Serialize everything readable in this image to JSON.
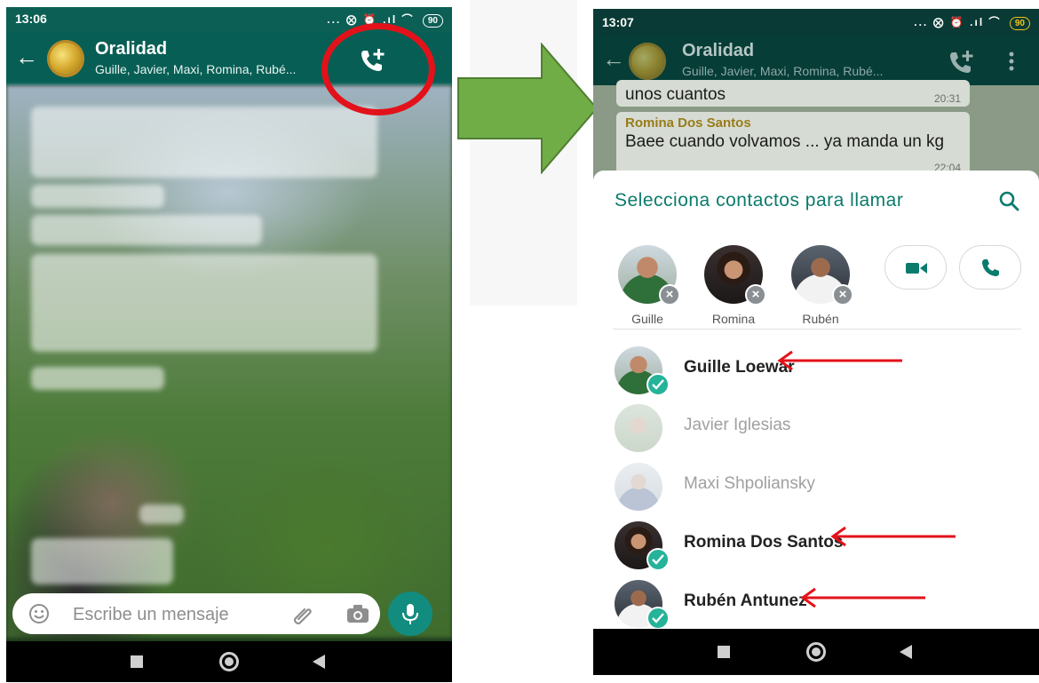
{
  "left_screen": {
    "status_time": "13:06",
    "status_icons": "... ⨂ ⏰ .ıl ⌒",
    "battery": "90",
    "chat": {
      "title": "Oralidad",
      "members": "Guille, Javier, Maxi, Romina, Rubé..."
    },
    "input": {
      "placeholder": "Escribe un mensaje"
    }
  },
  "right_screen": {
    "status_time": "13:07",
    "status_icons": "... ⨂ ⏰ .ıl ⌒",
    "battery": "90",
    "chat": {
      "title": "Oralidad",
      "members": "Guille, Javier, Maxi, Romina, Rubé..."
    },
    "messages": [
      {
        "sender": "",
        "text": "unos cuantos",
        "time": "20:31"
      },
      {
        "sender": "Romina Dos Santos",
        "text": "Baee cuando volvamos ... ya manda un kg",
        "time": "22:04"
      }
    ],
    "sheet": {
      "title": "Selecciona contactos para llamar",
      "selected_chips": [
        {
          "label": "Guille"
        },
        {
          "label": "Romina"
        },
        {
          "label": "Rubén"
        }
      ],
      "contacts": [
        {
          "name": "Guille Loewar",
          "selected": true
        },
        {
          "name": "Javier Iglesias",
          "selected": false
        },
        {
          "name": "Maxi Shpoliansky",
          "selected": false
        },
        {
          "name": "Romina Dos Santos",
          "selected": true
        },
        {
          "name": "Rubén Antunez",
          "selected": true
        }
      ]
    }
  },
  "colors": {
    "whatsapp_header": "#075e54",
    "accent_teal": "#0a7b6c",
    "check_green": "#25b39a",
    "annotation_red": "#e3121a",
    "transition_arrow_green": "#70ad47"
  },
  "icons": {
    "back": "left-arrow-icon",
    "add_call": "phone-plus-icon",
    "menu": "kebab-icon",
    "search": "search-icon",
    "video": "video-camera-icon",
    "voice": "phone-icon",
    "emoji": "emoji-icon",
    "attach": "paperclip-icon",
    "camera": "camera-icon",
    "mic": "microphone-icon"
  }
}
